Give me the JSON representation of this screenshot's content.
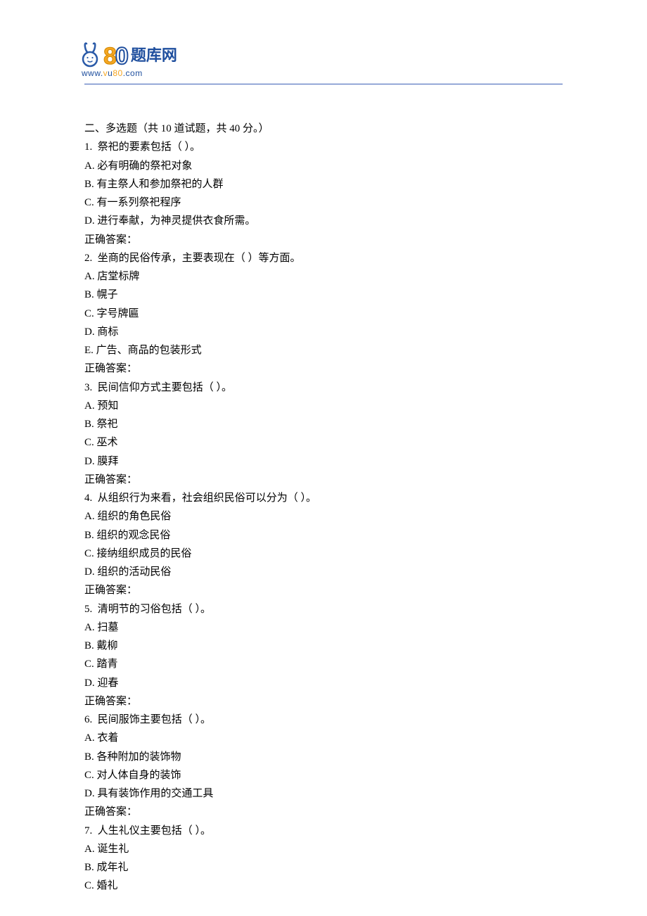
{
  "logo": {
    "brand_cn": "题库网",
    "url_prefix": "www.",
    "url_mid_v": "v",
    "url_mid_u": "u",
    "url_mid_80": "80",
    "url_suffix": ".com"
  },
  "section": {
    "title": "二、多选题（共 10 道试题，共 40 分。）"
  },
  "questions": [
    {
      "num": "1.",
      "stem": "祭祀的要素包括（ ）。",
      "options": [
        {
          "label": "A.",
          "text": "必有明确的祭祀对象"
        },
        {
          "label": "B.",
          "text": "有主祭人和参加祭祀的人群"
        },
        {
          "label": "C.",
          "text": "有一系列祭祀程序"
        },
        {
          "label": "D.",
          "text": "进行奉献，为神灵提供衣食所需。"
        }
      ],
      "answer_label": "正确答案："
    },
    {
      "num": "2.",
      "stem": "坐商的民俗传承，主要表现在（ ）等方面。",
      "options": [
        {
          "label": "A.",
          "text": "店堂标牌"
        },
        {
          "label": "B.",
          "text": "幌子"
        },
        {
          "label": "C.",
          "text": "字号牌匾"
        },
        {
          "label": "D.",
          "text": "商标"
        },
        {
          "label": "E.",
          "text": "广告、商品的包装形式"
        }
      ],
      "answer_label": "正确答案："
    },
    {
      "num": "3.",
      "stem": "民间信仰方式主要包括（ ）。",
      "options": [
        {
          "label": "A.",
          "text": "预知"
        },
        {
          "label": "B.",
          "text": "祭祀"
        },
        {
          "label": "C.",
          "text": "巫术"
        },
        {
          "label": "D.",
          "text": "膜拜"
        }
      ],
      "answer_label": "正确答案："
    },
    {
      "num": "4.",
      "stem": "从组织行为来看，社会组织民俗可以分为（ ）。",
      "options": [
        {
          "label": "A.",
          "text": "组织的角色民俗"
        },
        {
          "label": "B.",
          "text": "组织的观念民俗"
        },
        {
          "label": "C.",
          "text": "接纳组织成员的民俗"
        },
        {
          "label": "D.",
          "text": "组织的活动民俗"
        }
      ],
      "answer_label": "正确答案："
    },
    {
      "num": "5.",
      "stem": "清明节的习俗包括（ ）。",
      "options": [
        {
          "label": "A.",
          "text": "扫墓"
        },
        {
          "label": "B.",
          "text": "戴柳"
        },
        {
          "label": "C.",
          "text": "踏青"
        },
        {
          "label": "D.",
          "text": "迎春"
        }
      ],
      "answer_label": "正确答案："
    },
    {
      "num": "6.",
      "stem": "民间服饰主要包括（  ）。",
      "options": [
        {
          "label": "A.",
          "text": "衣着"
        },
        {
          "label": "B.",
          "text": "各种附加的装饰物"
        },
        {
          "label": "C.",
          "text": "对人体自身的装饰"
        },
        {
          "label": "D.",
          "text": "具有装饰作用的交通工具"
        }
      ],
      "answer_label": "正确答案："
    },
    {
      "num": "7.",
      "stem": "人生礼仪主要包括（ ）。",
      "options": [
        {
          "label": "A.",
          "text": "诞生礼"
        },
        {
          "label": "B.",
          "text": "成年礼"
        },
        {
          "label": "C.",
          "text": "婚礼"
        }
      ],
      "answer_label": ""
    }
  ]
}
